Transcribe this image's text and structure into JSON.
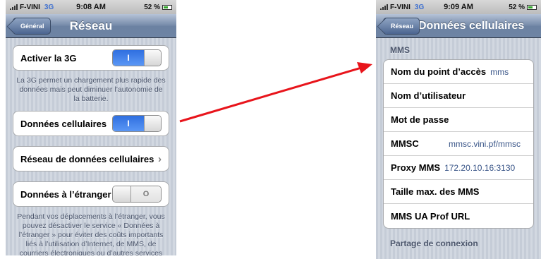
{
  "left_phone": {
    "status": {
      "carrier": "F-VINI",
      "network": "3G",
      "time": "9:08 AM",
      "battery": "52 %"
    },
    "nav": {
      "back": "Général",
      "title": "Réseau"
    },
    "activer_3g": {
      "label": "Activer la 3G",
      "toggle": "I"
    },
    "note_3g": "La 3G permet un chargement plus rapide des données mais peut diminuer l’autonomie de la batterie.",
    "donnees_cellulaires": {
      "label": "Données cellulaires",
      "toggle": "I"
    },
    "reseau_donnees": {
      "label": "Réseau de données cellulaires",
      "chevron": "›"
    },
    "donnees_etranger": {
      "label": "Données à l’étranger",
      "toggle": "O"
    },
    "note_etranger": "Pendant vos déplacements à l’étranger, vous pouvez désactiver le service « Données à l’étranger » pour éviter des coûts importants liés à l’utilisation d’Internet, de MMS, de courriers électroniques ou d’autres services de"
  },
  "right_phone": {
    "status": {
      "carrier": "F-VINI",
      "network": "3G",
      "time": "9:09 AM",
      "battery": "52 %"
    },
    "nav": {
      "back": "Réseau",
      "title": "Données cellulaires"
    },
    "section_mms": "MMS",
    "rows": [
      {
        "label": "Nom du point d’accès",
        "value": "mms"
      },
      {
        "label": "Nom d’utilisateur",
        "value": ""
      },
      {
        "label": "Mot de passe",
        "value": ""
      },
      {
        "label": "MMSC",
        "value": "mmsc.vini.pf/mmsc"
      },
      {
        "label": "Proxy MMS",
        "value": "172.20.10.16:3130"
      },
      {
        "label": "Taille max. des MMS",
        "value": ""
      },
      {
        "label": "MMS UA Prof URL",
        "value": ""
      }
    ],
    "section_partage": "Partage de connexion"
  },
  "colors": {
    "arrow": "#e8141b",
    "toggle_on": "#3c7fe8",
    "nav": "#6f85a5"
  }
}
